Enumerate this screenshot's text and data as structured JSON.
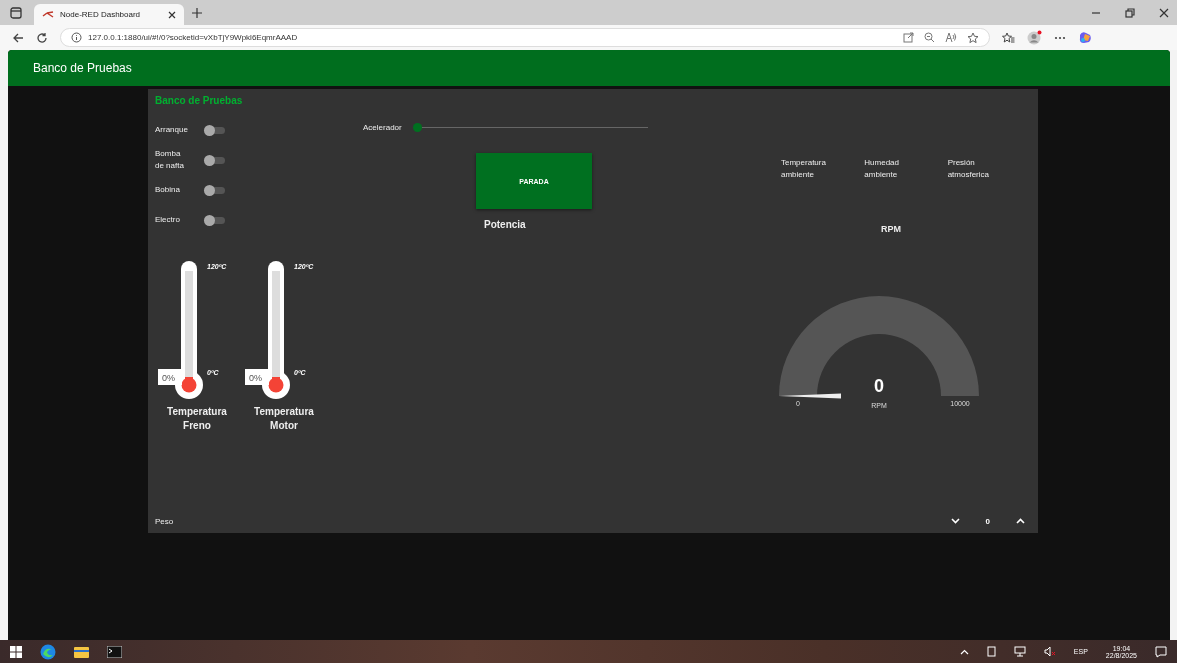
{
  "browser": {
    "tab_title": "Node-RED Dashboard",
    "address": "127.0.0.1:1880/ui/#!/0?socketid=vXbTjY9Wpkl6EqmrAAAD"
  },
  "header": {
    "title": "Banco de Pruebas"
  },
  "panel": {
    "title": "Banco de Pruebas",
    "switches": [
      {
        "label": "Arranque",
        "on": false
      },
      {
        "label": "Bomba\nde nafta",
        "on": false
      },
      {
        "label": "Bobina",
        "on": false
      },
      {
        "label": "Electro",
        "on": false
      }
    ],
    "slider": {
      "label": "Acelerador",
      "level": 0
    },
    "button": {
      "label": "PARADA"
    },
    "potencia": {
      "label": "Potencia"
    },
    "thermometers": [
      {
        "max": "120ºC",
        "min": "0ºC",
        "reading": "0%",
        "label": "Temperatura\nFreno",
        "level": 0
      },
      {
        "max": "120ºC",
        "min": "0ºC",
        "reading": "0%",
        "label": "Temperatura\nMotor",
        "level": 0
      }
    ],
    "sensors": [
      {
        "label": "Temperatura\nambiente"
      },
      {
        "label": "Humedad\nambiente"
      },
      {
        "label": "Presión\natmosferica"
      }
    ],
    "gauge": {
      "title": "RPM",
      "value": "0",
      "units": "RPM",
      "min": "0",
      "max": "10000"
    },
    "numeric": {
      "label": "Peso",
      "value": "0"
    }
  },
  "taskbar": {
    "language": "ESP",
    "time": "19:04",
    "date": "22/8/2025"
  }
}
